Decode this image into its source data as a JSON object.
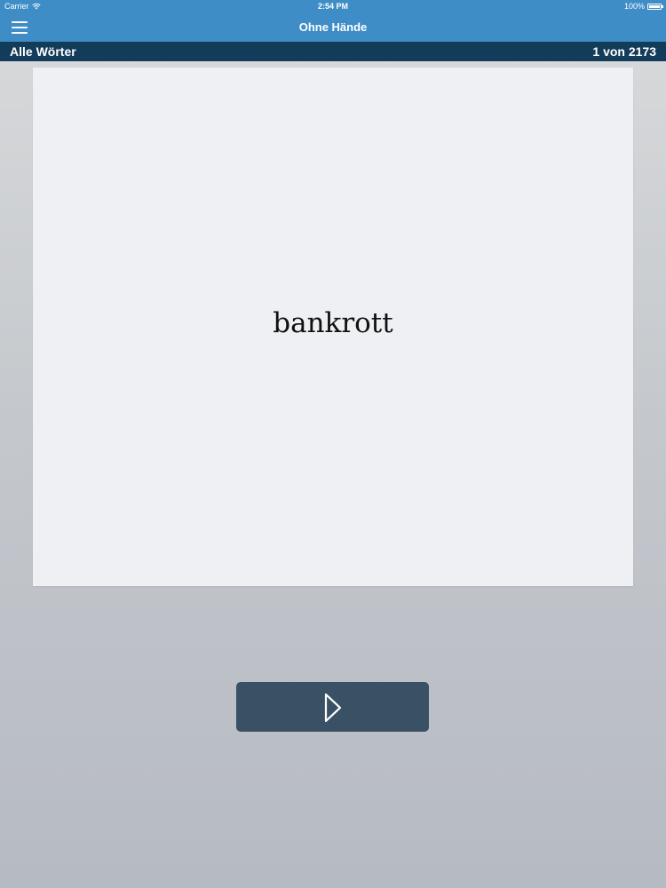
{
  "status_bar": {
    "carrier": "Carrier",
    "time": "2:54 PM",
    "battery": "100%",
    "icons": [
      "wifi-icon",
      "battery-icon"
    ]
  },
  "nav": {
    "title": "Ohne Hände",
    "menu_icon": "hamburger-menu-icon"
  },
  "sub_bar": {
    "list_name": "Alle Wörter",
    "counter": "1 von 2173"
  },
  "card": {
    "word": "bankrott"
  },
  "play_button": {
    "icon": "play-icon"
  },
  "colors": {
    "nav_bg": "#3f8dc6",
    "sub_bar_bg": "#133c5a",
    "card_bg": "#eef0f3",
    "button_bg": "#3a5064",
    "text_on_dark": "#ffffff"
  }
}
